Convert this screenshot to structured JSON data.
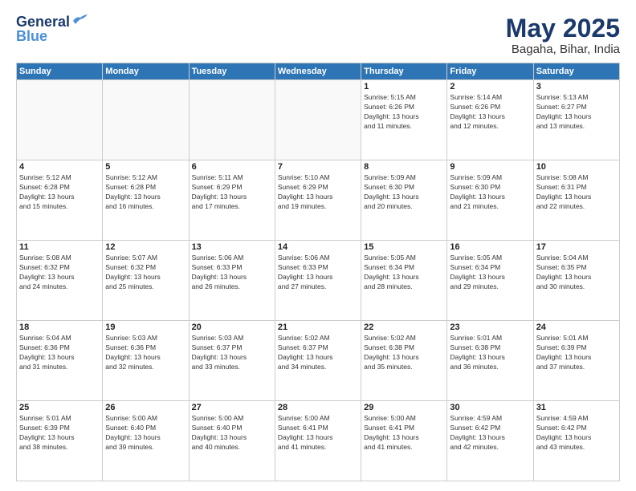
{
  "logo": {
    "line1": "General",
    "line2": "Blue"
  },
  "title": {
    "month": "May 2025",
    "location": "Bagaha, Bihar, India"
  },
  "headers": [
    "Sunday",
    "Monday",
    "Tuesday",
    "Wednesday",
    "Thursday",
    "Friday",
    "Saturday"
  ],
  "weeks": [
    [
      {
        "day": "",
        "info": "",
        "empty": true
      },
      {
        "day": "",
        "info": "",
        "empty": true
      },
      {
        "day": "",
        "info": "",
        "empty": true
      },
      {
        "day": "",
        "info": "",
        "empty": true
      },
      {
        "day": "1",
        "info": "Sunrise: 5:15 AM\nSunset: 6:26 PM\nDaylight: 13 hours\nand 11 minutes."
      },
      {
        "day": "2",
        "info": "Sunrise: 5:14 AM\nSunset: 6:26 PM\nDaylight: 13 hours\nand 12 minutes."
      },
      {
        "day": "3",
        "info": "Sunrise: 5:13 AM\nSunset: 6:27 PM\nDaylight: 13 hours\nand 13 minutes."
      }
    ],
    [
      {
        "day": "4",
        "info": "Sunrise: 5:12 AM\nSunset: 6:28 PM\nDaylight: 13 hours\nand 15 minutes."
      },
      {
        "day": "5",
        "info": "Sunrise: 5:12 AM\nSunset: 6:28 PM\nDaylight: 13 hours\nand 16 minutes."
      },
      {
        "day": "6",
        "info": "Sunrise: 5:11 AM\nSunset: 6:29 PM\nDaylight: 13 hours\nand 17 minutes."
      },
      {
        "day": "7",
        "info": "Sunrise: 5:10 AM\nSunset: 6:29 PM\nDaylight: 13 hours\nand 19 minutes."
      },
      {
        "day": "8",
        "info": "Sunrise: 5:09 AM\nSunset: 6:30 PM\nDaylight: 13 hours\nand 20 minutes."
      },
      {
        "day": "9",
        "info": "Sunrise: 5:09 AM\nSunset: 6:30 PM\nDaylight: 13 hours\nand 21 minutes."
      },
      {
        "day": "10",
        "info": "Sunrise: 5:08 AM\nSunset: 6:31 PM\nDaylight: 13 hours\nand 22 minutes."
      }
    ],
    [
      {
        "day": "11",
        "info": "Sunrise: 5:08 AM\nSunset: 6:32 PM\nDaylight: 13 hours\nand 24 minutes."
      },
      {
        "day": "12",
        "info": "Sunrise: 5:07 AM\nSunset: 6:32 PM\nDaylight: 13 hours\nand 25 minutes."
      },
      {
        "day": "13",
        "info": "Sunrise: 5:06 AM\nSunset: 6:33 PM\nDaylight: 13 hours\nand 26 minutes."
      },
      {
        "day": "14",
        "info": "Sunrise: 5:06 AM\nSunset: 6:33 PM\nDaylight: 13 hours\nand 27 minutes."
      },
      {
        "day": "15",
        "info": "Sunrise: 5:05 AM\nSunset: 6:34 PM\nDaylight: 13 hours\nand 28 minutes."
      },
      {
        "day": "16",
        "info": "Sunrise: 5:05 AM\nSunset: 6:34 PM\nDaylight: 13 hours\nand 29 minutes."
      },
      {
        "day": "17",
        "info": "Sunrise: 5:04 AM\nSunset: 6:35 PM\nDaylight: 13 hours\nand 30 minutes."
      }
    ],
    [
      {
        "day": "18",
        "info": "Sunrise: 5:04 AM\nSunset: 6:36 PM\nDaylight: 13 hours\nand 31 minutes."
      },
      {
        "day": "19",
        "info": "Sunrise: 5:03 AM\nSunset: 6:36 PM\nDaylight: 13 hours\nand 32 minutes."
      },
      {
        "day": "20",
        "info": "Sunrise: 5:03 AM\nSunset: 6:37 PM\nDaylight: 13 hours\nand 33 minutes."
      },
      {
        "day": "21",
        "info": "Sunrise: 5:02 AM\nSunset: 6:37 PM\nDaylight: 13 hours\nand 34 minutes."
      },
      {
        "day": "22",
        "info": "Sunrise: 5:02 AM\nSunset: 6:38 PM\nDaylight: 13 hours\nand 35 minutes."
      },
      {
        "day": "23",
        "info": "Sunrise: 5:01 AM\nSunset: 6:38 PM\nDaylight: 13 hours\nand 36 minutes."
      },
      {
        "day": "24",
        "info": "Sunrise: 5:01 AM\nSunset: 6:39 PM\nDaylight: 13 hours\nand 37 minutes."
      }
    ],
    [
      {
        "day": "25",
        "info": "Sunrise: 5:01 AM\nSunset: 6:39 PM\nDaylight: 13 hours\nand 38 minutes."
      },
      {
        "day": "26",
        "info": "Sunrise: 5:00 AM\nSunset: 6:40 PM\nDaylight: 13 hours\nand 39 minutes."
      },
      {
        "day": "27",
        "info": "Sunrise: 5:00 AM\nSunset: 6:40 PM\nDaylight: 13 hours\nand 40 minutes."
      },
      {
        "day": "28",
        "info": "Sunrise: 5:00 AM\nSunset: 6:41 PM\nDaylight: 13 hours\nand 41 minutes."
      },
      {
        "day": "29",
        "info": "Sunrise: 5:00 AM\nSunset: 6:41 PM\nDaylight: 13 hours\nand 41 minutes."
      },
      {
        "day": "30",
        "info": "Sunrise: 4:59 AM\nSunset: 6:42 PM\nDaylight: 13 hours\nand 42 minutes."
      },
      {
        "day": "31",
        "info": "Sunrise: 4:59 AM\nSunset: 6:42 PM\nDaylight: 13 hours\nand 43 minutes."
      }
    ]
  ]
}
